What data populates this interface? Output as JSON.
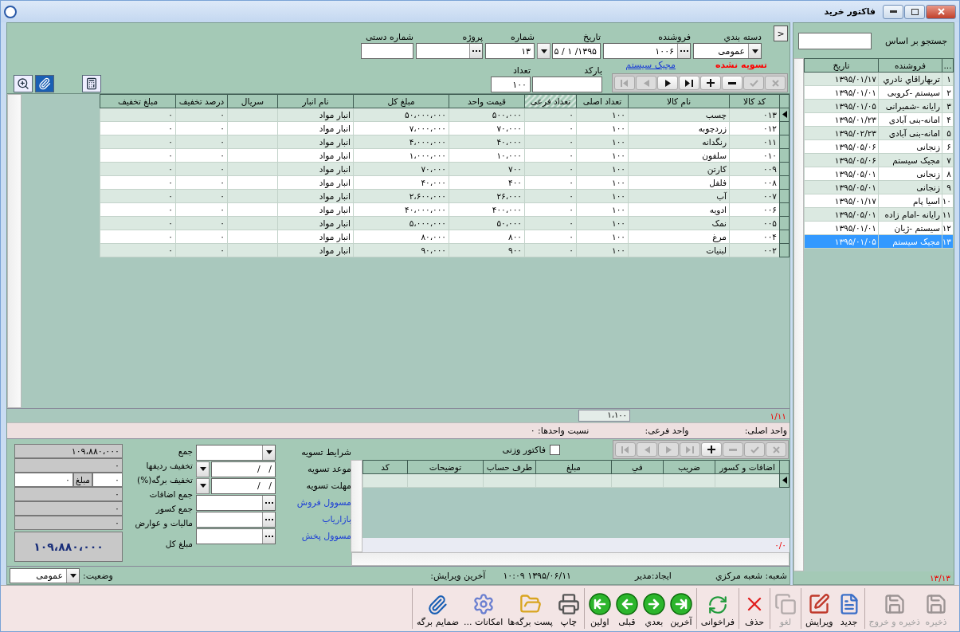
{
  "window": {
    "title": "فاکتور خرید"
  },
  "header": {
    "collapse_button": "<",
    "fields": [
      {
        "kind": "combo",
        "label": "دسته بندي",
        "value": "عمومی"
      },
      {
        "kind": "lookup",
        "label": "فروشنده",
        "value": "۱۰۰۶"
      },
      {
        "kind": "date",
        "label": "تاریخ",
        "value": "۱۳۹۵/ ۱ / ۵"
      },
      {
        "kind": "text",
        "label": "شماره",
        "value": "۱۳"
      },
      {
        "kind": "lookup",
        "label": "پروژه"
      },
      {
        "kind": "text",
        "label": "شماره دستی"
      }
    ],
    "settlement_status": "تسویه نشده",
    "seller_link": "مجیک سیستم",
    "navigator": [
      {
        "kind": "first",
        "disabled": true
      },
      {
        "kind": "prev",
        "disabled": true
      },
      {
        "kind": "next",
        "disabled": false
      },
      {
        "kind": "last",
        "disabled": false
      },
      {
        "kind": "add",
        "disabled": false
      },
      {
        "kind": "remove",
        "disabled": false
      },
      {
        "kind": "confirm",
        "disabled": true
      },
      {
        "kind": "cancel",
        "disabled": true
      }
    ],
    "barcode": {
      "label": "بارکد"
    },
    "quantity": {
      "label": "تعداد",
      "value": "۱۰۰"
    }
  },
  "items_table": {
    "columns": [
      {
        "label": "کد کالا",
        "readonly": false
      },
      {
        "label": "نام کالا",
        "readonly": false
      },
      {
        "label": "تعداد اصلی",
        "readonly": false
      },
      {
        "label": "تعداد فرعی",
        "readonly": true
      },
      {
        "label": "قیمت واحد",
        "readonly": false
      },
      {
        "label": "مبلغ کل",
        "readonly": false
      },
      {
        "label": "نام انبار",
        "readonly": false
      },
      {
        "label": "سریال",
        "readonly": false
      },
      {
        "label": "درصد تخفیف",
        "readonly": false
      },
      {
        "label": "مبلغ تخفیف",
        "readonly": false
      }
    ],
    "rows": [
      {
        "code": "۰۱۳",
        "name": "چسب",
        "qty": "۱۰۰",
        "sub_qty": "۰",
        "unit_price": "۵۰۰،۰۰۰",
        "total": "۵۰،۰۰۰،۰۰۰",
        "warehouse": "انبار مواد",
        "discount_percent": "۰",
        "discount_amount": "۰",
        "selected": true
      },
      {
        "code": "۰۱۲",
        "name": "زردچوبه",
        "qty": "۱۰۰",
        "sub_qty": "۰",
        "unit_price": "۷۰،۰۰۰",
        "total": "۷،۰۰۰،۰۰۰",
        "warehouse": "انبار مواد",
        "discount_percent": "۰",
        "discount_amount": "۰",
        "selected": false
      },
      {
        "code": "۰۱۱",
        "name": "رنگدانه",
        "qty": "۱۰۰",
        "sub_qty": "۰",
        "unit_price": "۴۰،۰۰۰",
        "total": "۴،۰۰۰،۰۰۰",
        "warehouse": "انبار مواد",
        "discount_percent": "۰",
        "discount_amount": "۰",
        "selected": false
      },
      {
        "code": "۰۱۰",
        "name": "سلفون",
        "qty": "۱۰۰",
        "sub_qty": "۰",
        "unit_price": "۱۰،۰۰۰",
        "total": "۱،۰۰۰،۰۰۰",
        "warehouse": "انبار مواد",
        "discount_percent": "۰",
        "discount_amount": "۰",
        "selected": false
      },
      {
        "code": "۰۰۹",
        "name": "کارتن",
        "qty": "۱۰۰",
        "sub_qty": "۰",
        "unit_price": "۷۰۰",
        "total": "۷۰،۰۰۰",
        "warehouse": "انبار مواد",
        "discount_percent": "۰",
        "discount_amount": "۰",
        "selected": false
      },
      {
        "code": "۰۰۸",
        "name": "فلفل",
        "qty": "۱۰۰",
        "sub_qty": "۰",
        "unit_price": "۴۰۰",
        "total": "۴۰،۰۰۰",
        "warehouse": "انبار مواد",
        "discount_percent": "۰",
        "discount_amount": "۰",
        "selected": false
      },
      {
        "code": "۰۰۷",
        "name": "آب",
        "qty": "۱۰۰",
        "sub_qty": "۰",
        "unit_price": "۲۶،۰۰۰",
        "total": "۲،۶۰۰،۰۰۰",
        "warehouse": "انبار مواد",
        "discount_percent": "۰",
        "discount_amount": "۰",
        "selected": false
      },
      {
        "code": "۰۰۶",
        "name": "ادویه",
        "qty": "۱۰۰",
        "sub_qty": "۰",
        "unit_price": "۴۰۰،۰۰۰",
        "total": "۴۰،۰۰۰،۰۰۰",
        "warehouse": "انبار مواد",
        "discount_percent": "۰",
        "discount_amount": "۰",
        "selected": false
      },
      {
        "code": "۰۰۵",
        "name": "نمک",
        "qty": "۱۰۰",
        "sub_qty": "۰",
        "unit_price": "۵۰،۰۰۰",
        "total": "۵،۰۰۰،۰۰۰",
        "warehouse": "انبار مواد",
        "discount_percent": "۰",
        "discount_amount": "۰",
        "selected": false
      },
      {
        "code": "۰۰۴",
        "name": "مرغ",
        "qty": "۱۰۰",
        "sub_qty": "۰",
        "unit_price": "۸۰۰",
        "total": "۸۰،۰۰۰",
        "warehouse": "انبار مواد",
        "discount_percent": "۰",
        "discount_amount": "۰",
        "selected": false
      },
      {
        "code": "۰۰۲",
        "name": "لبنیات",
        "qty": "۱۰۰",
        "sub_qty": "۰",
        "unit_price": "۹۰۰",
        "total": "۹۰،۰۰۰",
        "warehouse": "انبار مواد",
        "discount_percent": "۰",
        "discount_amount": "۰",
        "selected": false
      }
    ],
    "position": "۱/۱۱",
    "total_quantity": "۱،۱۰۰"
  },
  "unit_bar": {
    "main_unit": "واحد اصلی:",
    "sub_unit": "واحد فرعی:",
    "unit_ratio": "نسبت واحدها: ۰"
  },
  "extras": {
    "navigator": [
      {
        "kind": "first",
        "disabled": true
      },
      {
        "kind": "prev",
        "disabled": true
      },
      {
        "kind": "next",
        "disabled": true
      },
      {
        "kind": "last",
        "disabled": true
      },
      {
        "kind": "add",
        "disabled": false
      },
      {
        "kind": "remove",
        "disabled": true
      },
      {
        "kind": "confirm",
        "disabled": true
      },
      {
        "kind": "cancel",
        "disabled": true
      }
    ],
    "weight_invoice": {
      "label": "فاکتور وزنی",
      "checked": false
    },
    "columns": [
      "اضافات و کسور",
      "ضریب",
      "في",
      "مبلغ",
      "طرف حساب",
      "توضیحات",
      "کد"
    ],
    "position": "۰/۰"
  },
  "settlement": [
    {
      "kind": "combo",
      "label": "شرایط تسویه"
    },
    {
      "kind": "date",
      "label": "موعد تسویه",
      "value": "/   /"
    },
    {
      "kind": "date",
      "label": "مهلت تسویه",
      "value": "/   /"
    },
    {
      "kind": "lookup",
      "label": "مسوول فروش"
    },
    {
      "kind": "lookup",
      "label": "بازاریاب"
    },
    {
      "kind": "lookup",
      "label": "مسوول پخش"
    }
  ],
  "totals": [
    {
      "kind": "readonly",
      "label": "جمع",
      "value": "۱۰۹،۸۸۰،۰۰۰"
    },
    {
      "kind": "readonly",
      "label": "تخفیف ردیفها",
      "value": "۰"
    },
    {
      "kind": "discount",
      "label": "تخفیف برگه(%)",
      "value": "۰",
      "amount_label": "مبلغ",
      "amount": "۰"
    },
    {
      "kind": "readonly",
      "label": "جمع اضافات",
      "value": "۰"
    },
    {
      "kind": "readonly",
      "label": "جمع کسور",
      "value": "۰"
    },
    {
      "kind": "readonly",
      "label": "مالیات و عوارض",
      "value": "۰"
    },
    {
      "kind": "grand",
      "label": "مبلغ کل",
      "value": "۱۰۹،۸۸۰،۰۰۰"
    }
  ],
  "status_bar": {
    "branch": "شعبه: شعبه مرکزي",
    "created_by": "ایجاد:مدیر",
    "created_at": "۱۳۹۵/۰۶/۱۱ ۱۰:۰۹",
    "last_edit": "آخرین ویرایش:",
    "state_label": "وضعیت:",
    "state_value": "عمومی"
  },
  "sidebar": {
    "search_label": "جستجو بر اساس",
    "columns": [
      "...",
      "فروشنده",
      "تاریخ"
    ],
    "rows": [
      {
        "number": "۱",
        "seller": "تربهاراقاي نادري",
        "date": "۱۳۹۵/۰۱/۱۷",
        "selected": false
      },
      {
        "number": "۲",
        "seller": "سیستم -کروبی",
        "date": "۱۳۹۵/۰۱/۰۱",
        "selected": false
      },
      {
        "number": "۳",
        "seller": "رایانه -شمیرانی",
        "date": "۱۳۹۵/۰۱/۰۵",
        "selected": false
      },
      {
        "number": "۴",
        "seller": "امانه-بنی آبادی",
        "date": "۱۳۹۵/۰۱/۲۳",
        "selected": false
      },
      {
        "number": "۵",
        "seller": "امانه-بنی آبادی",
        "date": "۱۳۹۵/۰۲/۲۳",
        "selected": false
      },
      {
        "number": "۶",
        "seller": "زنجانی",
        "date": "۱۳۹۵/۰۵/۰۶",
        "selected": false
      },
      {
        "number": "۷",
        "seller": "مجیک سیستم",
        "date": "۱۳۹۵/۰۵/۰۶",
        "selected": false
      },
      {
        "number": "۸",
        "seller": "زنجانی",
        "date": "۱۳۹۵/۰۵/۰۱",
        "selected": false
      },
      {
        "number": "۹",
        "seller": "زنجانی",
        "date": "۱۳۹۵/۰۵/۰۱",
        "selected": false
      },
      {
        "number": "۱۰",
        "seller": "اسیا پام",
        "date": "۱۳۹۵/۰۱/۱۷",
        "selected": false
      },
      {
        "number": "۱۱",
        "seller": "رایانه -امام زاده",
        "date": "۱۳۹۵/۰۵/۰۱",
        "selected": false
      },
      {
        "number": "۱۲",
        "seller": "سیستم -ژیان",
        "date": "۱۳۹۵/۰۱/۰۱",
        "selected": false
      },
      {
        "number": "۱۳",
        "seller": "مجیک سیستم",
        "date": "۱۳۹۵/۰۱/۰۵",
        "selected": true
      }
    ],
    "position": "۱۳/۱۳"
  },
  "toolbar": {
    "groups": [
      [
        {
          "kind": "save",
          "label": "ذخیره",
          "disabled": true
        },
        {
          "kind": "save_exit",
          "label": "ذخیره و خروج",
          "disabled": true
        }
      ],
      [
        {
          "kind": "new",
          "label": "جدید",
          "disabled": false
        },
        {
          "kind": "edit",
          "label": "ویرایش",
          "disabled": false
        }
      ],
      [
        {
          "kind": "undo",
          "label": "لغو",
          "disabled": true
        }
      ],
      [
        {
          "kind": "delete",
          "label": "حذف",
          "disabled": false
        }
      ],
      [
        {
          "kind": "recall",
          "label": "فراخوانی",
          "disabled": false
        }
      ],
      [
        {
          "kind": "last",
          "label": "آخرین",
          "disabled": false
        },
        {
          "kind": "next",
          "label": "بعدي",
          "disabled": false
        },
        {
          "kind": "prev",
          "label": "قبلی",
          "disabled": false
        },
        {
          "kind": "first",
          "label": "اولین",
          "disabled": false
        }
      ],
      [
        {
          "kind": "print",
          "label": "چاپ",
          "disabled": false
        },
        {
          "kind": "post",
          "label": "پست برگه‌ها",
          "disabled": false
        },
        {
          "kind": "options",
          "label": "امکانات ...",
          "disabled": false
        },
        {
          "kind": "attach",
          "label": "ضمایم برگه",
          "disabled": false
        }
      ]
    ]
  }
}
